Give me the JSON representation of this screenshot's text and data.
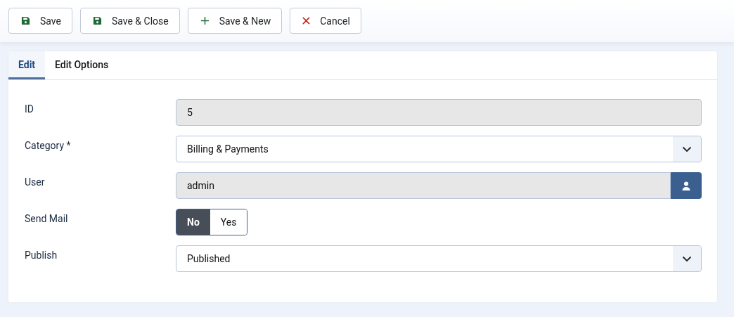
{
  "toolbar": [
    {
      "label": "Save",
      "kind": "save"
    },
    {
      "label": "Save & Close",
      "kind": "save"
    },
    {
      "label": "Save & New",
      "kind": "new"
    },
    {
      "label": "Cancel",
      "kind": "cancel"
    }
  ],
  "tabs": [
    {
      "label": "Edit",
      "selected": true
    },
    {
      "label": "Edit Options",
      "selected": false
    }
  ],
  "fields": [
    {
      "label": "ID",
      "kind": "readonly",
      "value": "5"
    },
    {
      "label": "Category *",
      "kind": "select",
      "value": "Billing & Payments"
    },
    {
      "label": "User",
      "kind": "user",
      "value": "admin"
    },
    {
      "label": "Send Mail",
      "kind": "switch",
      "options": [
        {
          "label": "No",
          "selected": true
        },
        {
          "label": "Yes",
          "selected": false
        }
      ]
    },
    {
      "label": "Publish",
      "kind": "select",
      "value": "Published"
    }
  ]
}
